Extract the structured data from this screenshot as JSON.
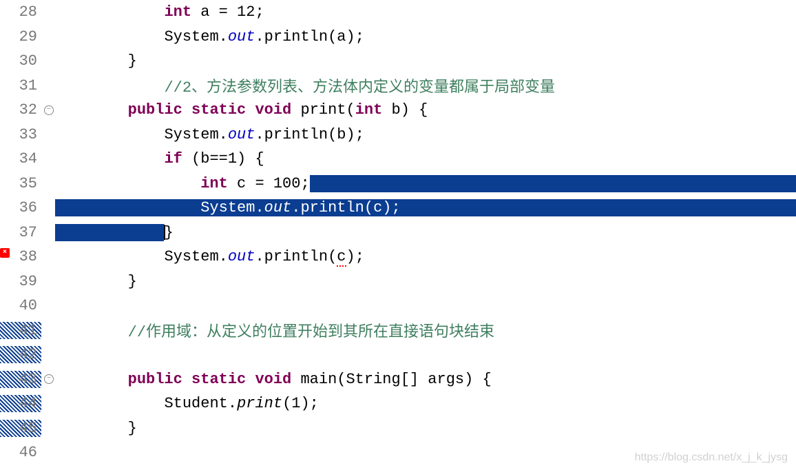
{
  "watermark": "https://blog.csdn.net/x_j_k_jysg",
  "lines": [
    {
      "num": "28",
      "indent": "            ",
      "tokens": [
        {
          "t": "int ",
          "c": "kw"
        },
        {
          "t": "a = 12;"
        }
      ]
    },
    {
      "num": "29",
      "indent": "            ",
      "tokens": [
        {
          "t": "System."
        },
        {
          "t": "out",
          "c": "field"
        },
        {
          "t": ".println(a);"
        }
      ]
    },
    {
      "num": "30",
      "indent": "        ",
      "tokens": [
        {
          "t": "}"
        }
      ]
    },
    {
      "num": "31",
      "indent": "            ",
      "tokens": [
        {
          "t": "//2、方法参数列表、方法体内定义的变量都属于局部变量",
          "c": "comment"
        }
      ]
    },
    {
      "num": "32",
      "indent": "        ",
      "fold": true,
      "tokens": [
        {
          "t": "public static void ",
          "c": "kw"
        },
        {
          "t": "print("
        },
        {
          "t": "int ",
          "c": "kw"
        },
        {
          "t": "b) {"
        }
      ]
    },
    {
      "num": "33",
      "indent": "            ",
      "tokens": [
        {
          "t": "System."
        },
        {
          "t": "out",
          "c": "field"
        },
        {
          "t": ".println(b);"
        }
      ]
    },
    {
      "num": "34",
      "indent": "            ",
      "tokens": [
        {
          "t": "if ",
          "c": "kw"
        },
        {
          "t": "(b==1) {"
        }
      ]
    },
    {
      "num": "35",
      "indent": "                ",
      "sel_partial_start": true,
      "tokens_before": [
        {
          "t": "int ",
          "c": "kw"
        },
        {
          "t": "c = 100;"
        }
      ]
    },
    {
      "num": "36",
      "indent": "                ",
      "sel_full": true,
      "tokens": [
        {
          "t": "System."
        },
        {
          "t": "out",
          "c": "field"
        },
        {
          "t": ".println(c);"
        }
      ]
    },
    {
      "num": "37",
      "indent": "            ",
      "sel_end_caret": true,
      "tokens": [
        {
          "t": "}"
        }
      ]
    },
    {
      "num": "38",
      "indent": "            ",
      "error": true,
      "tokens": [
        {
          "t": "System."
        },
        {
          "t": "out",
          "c": "field"
        },
        {
          "t": ".println("
        },
        {
          "t": "c",
          "c": "error-underline"
        },
        {
          "t": ");"
        }
      ]
    },
    {
      "num": "39",
      "indent": "        ",
      "tokens": [
        {
          "t": "}"
        }
      ]
    },
    {
      "num": "40",
      "indent": "",
      "tokens": []
    },
    {
      "num": "41",
      "indent": "        ",
      "ins": true,
      "tokens": [
        {
          "t": "//作用域：从定义的位置开始到其所在直接语句块结束",
          "c": "comment"
        }
      ]
    },
    {
      "num": "42",
      "indent": "",
      "ins": true,
      "tokens": []
    },
    {
      "num": "43",
      "indent": "        ",
      "ins": true,
      "fold": true,
      "tokens": [
        {
          "t": "public static void ",
          "c": "kw"
        },
        {
          "t": "main(String[] args) {"
        }
      ]
    },
    {
      "num": "44",
      "indent": "            ",
      "ins": true,
      "tokens": [
        {
          "t": "Student."
        },
        {
          "t": "print",
          "c": ""
        },
        {
          "t": "(1);"
        }
      ]
    },
    {
      "num": "45",
      "indent": "        ",
      "ins": true,
      "tokens": [
        {
          "t": "}"
        }
      ]
    },
    {
      "num": "46",
      "indent": "",
      "tokens": []
    }
  ]
}
